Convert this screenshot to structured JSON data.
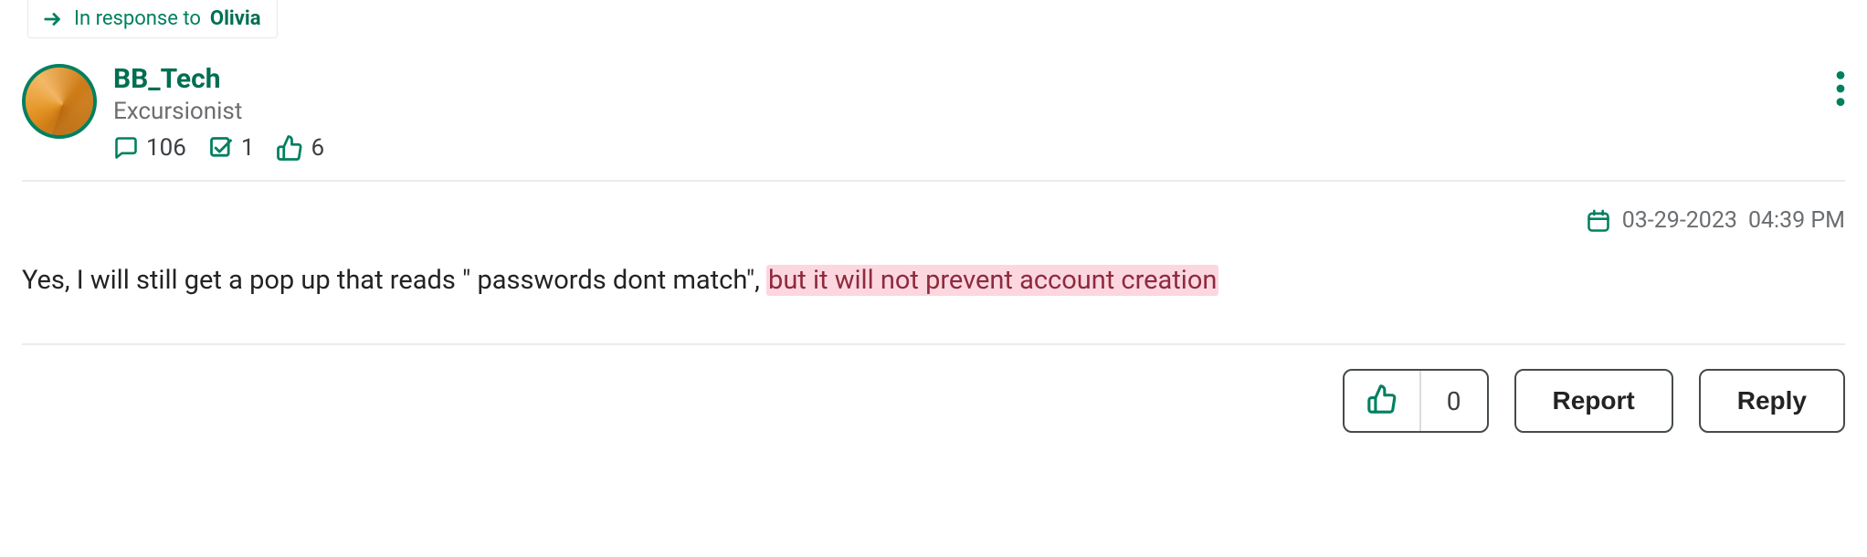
{
  "in_response": {
    "prefix": "In response to",
    "name": "Olivia"
  },
  "author": {
    "username": "BB_Tech",
    "rank": "Excursionist",
    "stats": {
      "posts": "106",
      "solutions": "1",
      "likes": "6"
    }
  },
  "timestamp": {
    "date": "03-29-2023",
    "time": "04:39 PM"
  },
  "body": {
    "text_before": "Yes, I will still get a pop up that reads \" passwords dont match\", ",
    "highlighted": "but it will not prevent account creation"
  },
  "actions": {
    "like_count": "0",
    "report_label": "Report",
    "reply_label": "Reply"
  }
}
